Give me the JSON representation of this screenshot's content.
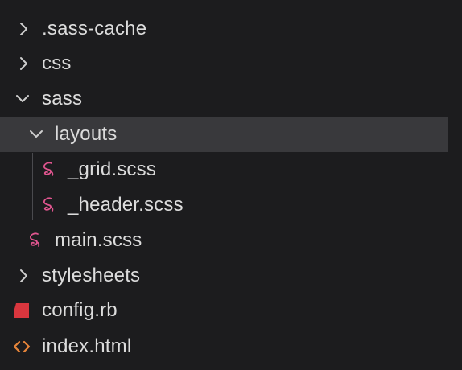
{
  "tree": {
    "items": [
      {
        "label": ".sass-cache",
        "type": "folder",
        "state": "collapsed",
        "icon": "chevron-right-icon"
      },
      {
        "label": "css",
        "type": "folder",
        "state": "collapsed",
        "icon": "chevron-right-icon"
      },
      {
        "label": "sass",
        "type": "folder",
        "state": "expanded",
        "icon": "chevron-down-icon"
      },
      {
        "label": "layouts",
        "type": "folder",
        "state": "expanded",
        "selected": true,
        "icon": "chevron-down-icon"
      },
      {
        "label": "_grid.scss",
        "type": "file",
        "icon": "sass-file-icon"
      },
      {
        "label": "_header.scss",
        "type": "file",
        "icon": "sass-file-icon"
      },
      {
        "label": "main.scss",
        "type": "file",
        "icon": "sass-file-icon"
      },
      {
        "label": "stylesheets",
        "type": "folder",
        "state": "collapsed",
        "icon": "chevron-right-icon"
      },
      {
        "label": "config.rb",
        "type": "file",
        "icon": "ruby-file-icon"
      },
      {
        "label": "index.html",
        "type": "file",
        "icon": "html-file-icon"
      }
    ]
  },
  "colors": {
    "background": "#1c1c1e",
    "selected_row": "#39393c",
    "text": "#dcdcdc",
    "sass_icon": "#e0558f",
    "ruby_icon": "#d9363e",
    "html_icon": "#e8853a"
  }
}
